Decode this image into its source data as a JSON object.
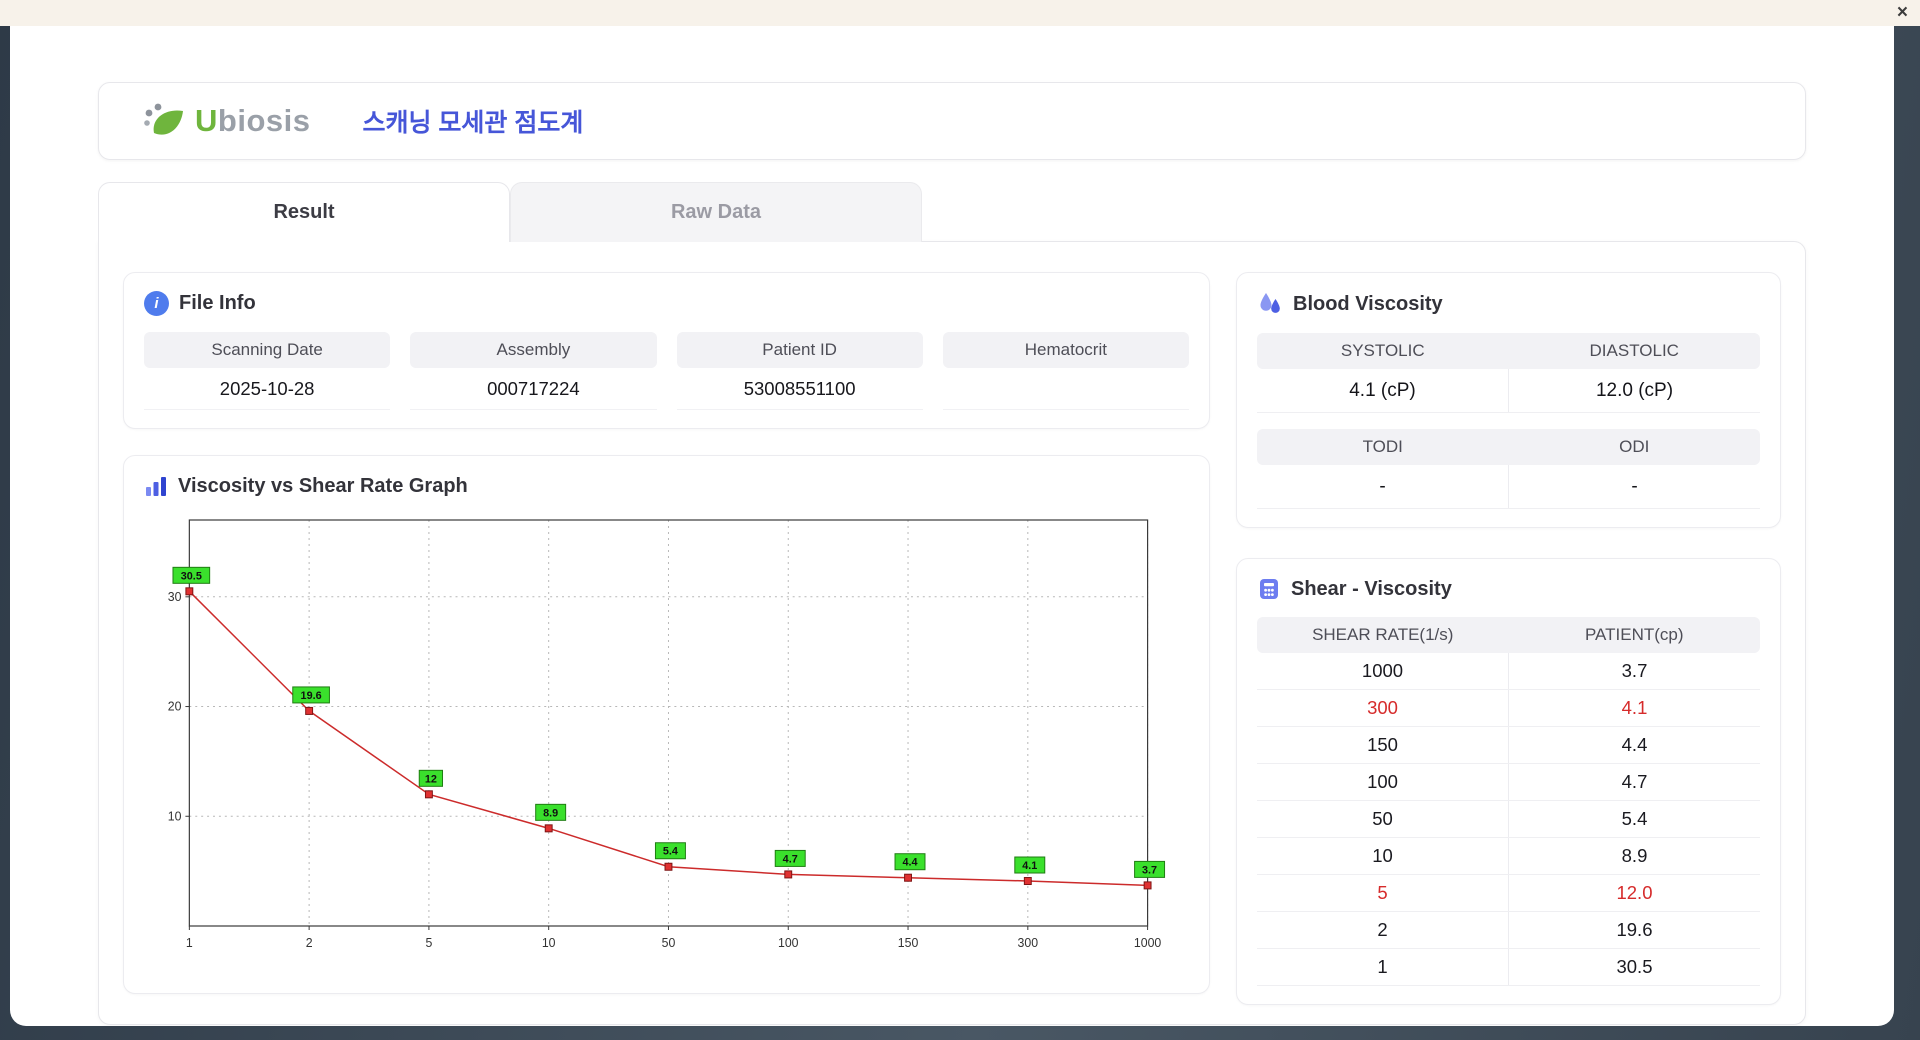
{
  "window": {
    "close_label": "×"
  },
  "header": {
    "logo_u": "U",
    "logo_rest": "biosis",
    "title": "스캐닝 모세관 점도계"
  },
  "tabs": [
    {
      "label": "Result",
      "active": true
    },
    {
      "label": "Raw Data",
      "active": false
    }
  ],
  "file_info": {
    "title": "File Info",
    "fields": [
      {
        "label": "Scanning Date",
        "value": "2025-10-28"
      },
      {
        "label": "Assembly",
        "value": "000717224"
      },
      {
        "label": "Patient ID",
        "value": "53008551100"
      },
      {
        "label": "Hematocrit",
        "value": ""
      }
    ]
  },
  "chart_data": {
    "type": "line",
    "title": "Viscosity vs Shear Rate Graph",
    "x": [
      "1",
      "2",
      "5",
      "10",
      "50",
      "100",
      "150",
      "300",
      "1000"
    ],
    "values": [
      30.5,
      19.6,
      12.0,
      8.9,
      5.4,
      4.7,
      4.4,
      4.1,
      3.7
    ],
    "point_labels": [
      "30.5",
      "19.6",
      "12",
      "8.9",
      "5.4",
      "4.7",
      "4.4",
      "4.1",
      "3.7"
    ],
    "xlabel": "",
    "ylabel": "",
    "x_scale": "categorical",
    "ylim": [
      0,
      37
    ],
    "yticks": [
      10,
      20,
      30
    ],
    "grid": true,
    "line_color": "#cc2b2b",
    "marker_color": "#e03131",
    "marker_border": "#7d1414",
    "label_bg": "#3ae02c",
    "label_border": "#1f7d12",
    "legend": "none"
  },
  "blood_viscosity": {
    "title": "Blood Viscosity",
    "rows": [
      {
        "labels": [
          "SYSTOLIC",
          "DIASTOLIC"
        ],
        "values": [
          "4.1 (cP)",
          "12.0 (cP)"
        ]
      },
      {
        "labels": [
          "TODI",
          "ODI"
        ],
        "values": [
          "-",
          "-"
        ]
      }
    ]
  },
  "shear_viscosity": {
    "title": "Shear - Viscosity",
    "columns": [
      "SHEAR RATE(1/s)",
      "PATIENT(cp)"
    ],
    "rows": [
      {
        "shear": "1000",
        "patient": "3.7",
        "highlight": false
      },
      {
        "shear": "300",
        "patient": "4.1",
        "highlight": true
      },
      {
        "shear": "150",
        "patient": "4.4",
        "highlight": false
      },
      {
        "shear": "100",
        "patient": "4.7",
        "highlight": false
      },
      {
        "shear": "50",
        "patient": "5.4",
        "highlight": false
      },
      {
        "shear": "10",
        "patient": "8.9",
        "highlight": false
      },
      {
        "shear": "5",
        "patient": "12.0",
        "highlight": true
      },
      {
        "shear": "2",
        "patient": "19.6",
        "highlight": false
      },
      {
        "shear": "1",
        "patient": "30.5",
        "highlight": false
      }
    ]
  },
  "colors": {
    "accent_blue": "#4656d8",
    "highlight_red": "#d62b2b",
    "logo_green": "#6fb53d",
    "header_grey": "#f2f2f5"
  }
}
